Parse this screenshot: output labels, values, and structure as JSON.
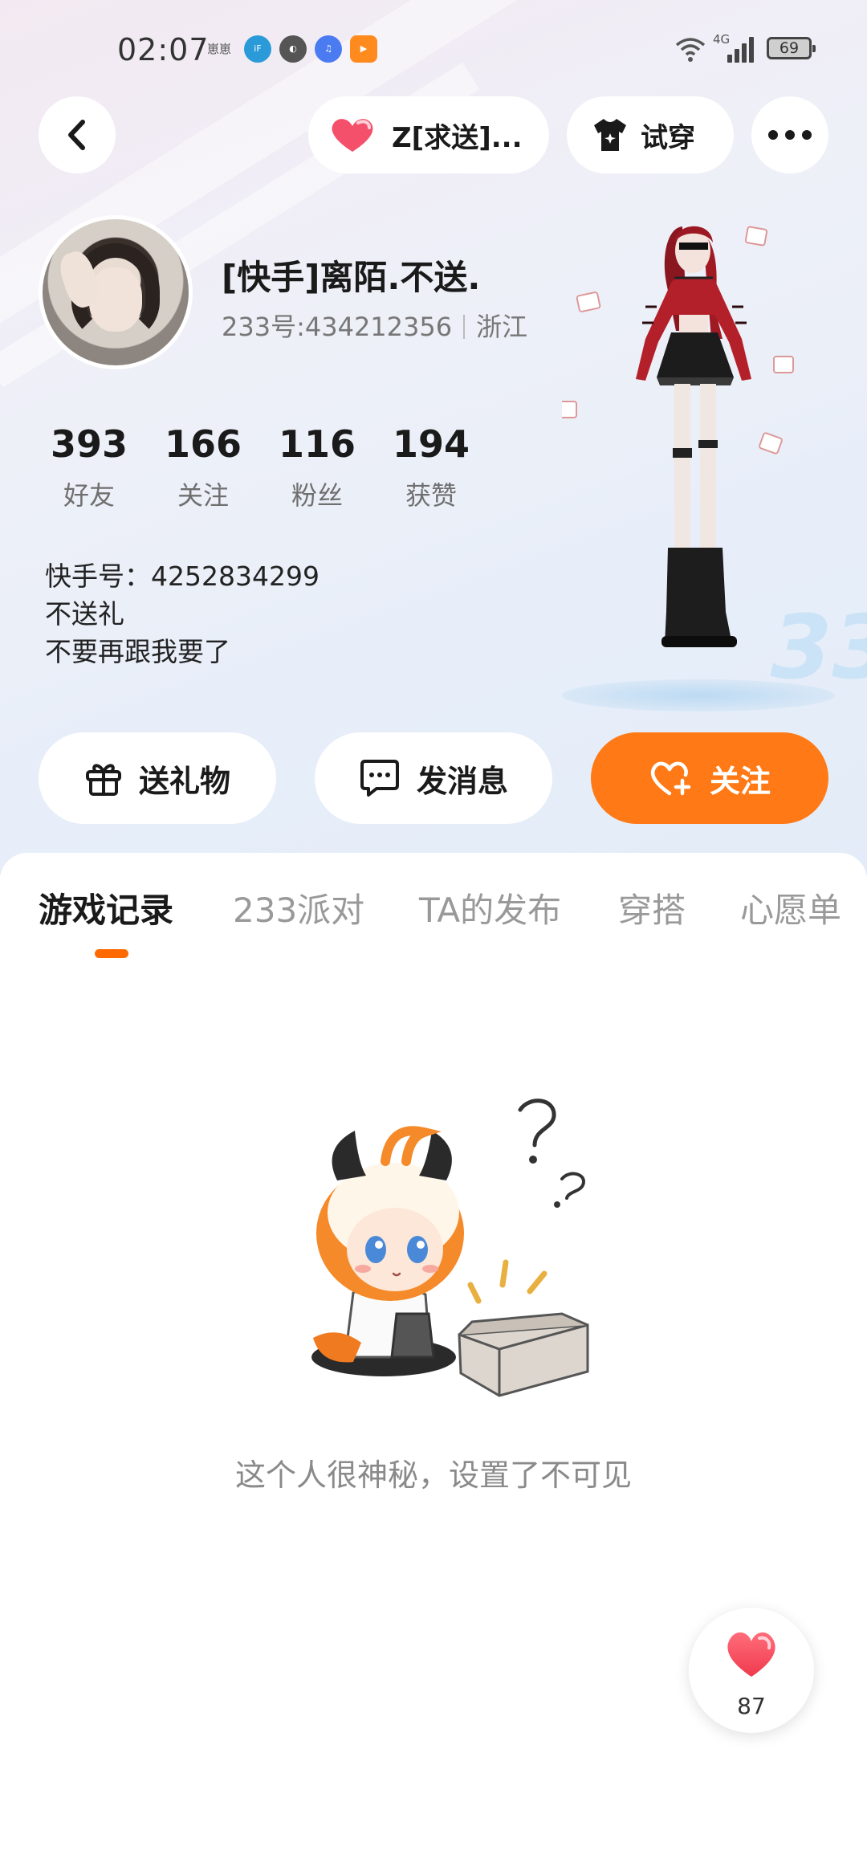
{
  "status_bar": {
    "time": "02:07",
    "notif_text": "崽崽",
    "notif_icons": [
      "iflytek-icon",
      "app-ball-icon",
      "music-icon",
      "video-icon"
    ],
    "network": "4G",
    "battery": "69"
  },
  "top_nav": {
    "back_icon": "chevron-left-icon",
    "title_pill_label": "Z[求送]...",
    "try_on_label": "试穿",
    "more_icon": "more-dots-icon"
  },
  "profile": {
    "nickname": "[快手]离陌.不送.",
    "id": "233号:434212356",
    "region": "浙江",
    "stats": [
      {
        "value": "393",
        "label": "好友"
      },
      {
        "value": "166",
        "label": "关注"
      },
      {
        "value": "116",
        "label": "粉丝"
      },
      {
        "value": "194",
        "label": "获赞"
      }
    ],
    "bio_lines": [
      "快手号：4252834299",
      "不送礼",
      "不要再跟我要了"
    ]
  },
  "actions": {
    "gift_label": "送礼物",
    "message_label": "发消息",
    "follow_label": "关注"
  },
  "tabs": [
    "游戏记录",
    "233派对",
    "TA的发布",
    "穿搭",
    "心愿单"
  ],
  "active_tab": "游戏记录",
  "empty_state": {
    "text": "这个人很神秘，设置了不可见"
  },
  "like": {
    "count": "87"
  },
  "colors": {
    "accent": "#ff7a16",
    "heart": "#f4506b"
  }
}
